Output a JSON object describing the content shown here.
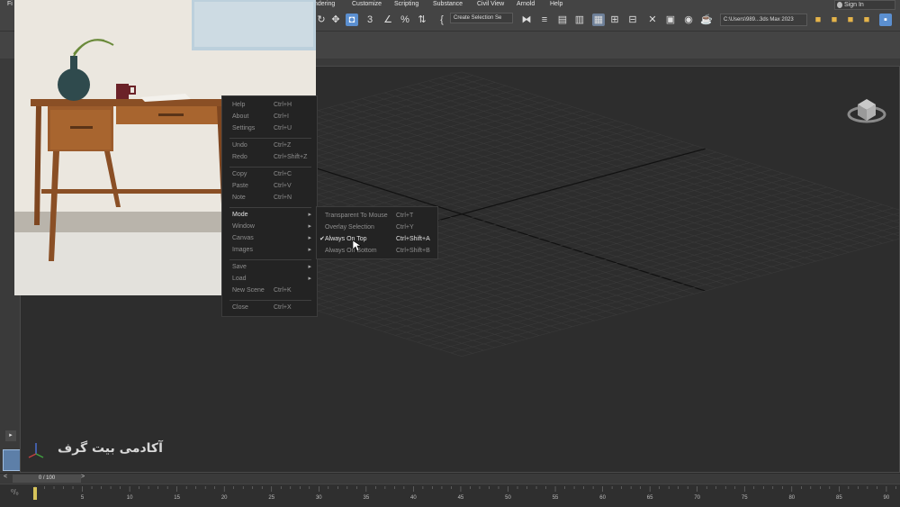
{
  "menubar": {
    "items": [
      "Fi",
      "Rendering",
      "Customize",
      "Scripting",
      "Substance",
      "Civil View",
      "Arnold",
      "Help"
    ],
    "sign_in": "Sign In"
  },
  "toolbar": {
    "selection_set": "Create Selection Se",
    "path": "C:\\Users\\989...3ds Max 2023"
  },
  "left": {
    "p_label": "P"
  },
  "context_menu": {
    "items": [
      {
        "label": "Help",
        "shortcut": "Ctrl+H"
      },
      {
        "label": "About",
        "shortcut": "Ctrl+I"
      },
      {
        "label": "Settings",
        "shortcut": "Ctrl+U"
      },
      {
        "label": "Undo",
        "shortcut": "Ctrl+Z"
      },
      {
        "label": "Redo",
        "shortcut": "Ctrl+Shift+Z"
      },
      {
        "label": "Copy",
        "shortcut": "Ctrl+C"
      },
      {
        "label": "Paste",
        "shortcut": "Ctrl+V"
      },
      {
        "label": "Note",
        "shortcut": "Ctrl+N"
      },
      {
        "label": "Mode",
        "shortcut": ""
      },
      {
        "label": "Window",
        "shortcut": ""
      },
      {
        "label": "Canvas",
        "shortcut": ""
      },
      {
        "label": "Images",
        "shortcut": ""
      },
      {
        "label": "Save",
        "shortcut": ""
      },
      {
        "label": "Load",
        "shortcut": ""
      },
      {
        "label": "New Scene",
        "shortcut": "Ctrl+K"
      },
      {
        "label": "Close",
        "shortcut": "Ctrl+X"
      }
    ]
  },
  "mode_submenu": {
    "items": [
      {
        "label": "Transparent To Mouse",
        "shortcut": "Ctrl+T",
        "checked": false
      },
      {
        "label": "Overlay Selection",
        "shortcut": "Ctrl+Y",
        "checked": false
      },
      {
        "label": "Always On Top",
        "shortcut": "Ctrl+Shift+A",
        "checked": true
      },
      {
        "label": "Always On Bottom",
        "shortcut": "Ctrl+Shift+B",
        "checked": false
      }
    ]
  },
  "watermark": "آکادمی بیت گرف",
  "timeline": {
    "frame_display": "0 / 100",
    "prev": "<",
    "next": ">",
    "ticks": [
      "5",
      "10",
      "15",
      "20",
      "25",
      "30",
      "35",
      "40",
      "45",
      "50",
      "55",
      "60",
      "65",
      "70",
      "75",
      "80",
      "85",
      "90"
    ]
  }
}
